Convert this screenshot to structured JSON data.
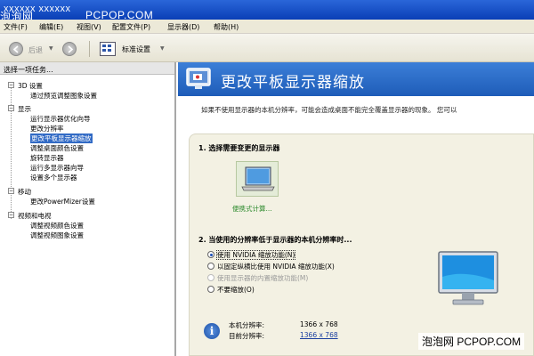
{
  "window": {
    "title": "xxxxxx  xxxxxx"
  },
  "watermark": {
    "top_cn": "泡泡网",
    "top_en": "PCPOP.COM",
    "bottom": "泡泡网  PCPOP.COM"
  },
  "menu": [
    {
      "label": "文件(F)"
    },
    {
      "label": "编辑(E)"
    },
    {
      "label": "视图(V)"
    },
    {
      "label": "配置文件(P)"
    },
    {
      "label": "显示器(D)"
    },
    {
      "label": "帮助(H)"
    }
  ],
  "toolbar": {
    "back_label": "后退",
    "standard_label": "标准设置"
  },
  "sidebar": {
    "header": "选择一项任务...",
    "groups": [
      {
        "label": "3D 设置",
        "items": [
          "通过预览调整图象设置"
        ]
      },
      {
        "label": "显示",
        "items": [
          "运行显示器优化向导",
          "更改分辨率",
          "更改平板显示器缩放",
          "调整桌面颜色设置",
          "旋转显示器",
          "运行多显示器向导",
          "设置多个显示器"
        ]
      },
      {
        "label": "移动",
        "items": [
          "更改PowerMizer设置"
        ]
      },
      {
        "label": "视频和电视",
        "items": [
          "调整视频颜色设置",
          "调整视频图象设置"
        ]
      }
    ],
    "selected": "更改平板显示器缩放"
  },
  "content": {
    "title": "更改平板显示器缩放",
    "description": "如果不使用显示器的本机分辨率，可能会造成桌面不能完全覆盖显示器的现象。 您可以",
    "step1": "1. 选择需要变更的显示器",
    "display_label": "便携式计算...",
    "step2": "2. 当使用的分辨率低于显示器的本机分辨率时...",
    "options": [
      {
        "label": "使用 NVIDIA 缩放功能(N)",
        "selected": true,
        "disabled": false
      },
      {
        "label": "以固定纵横比使用 NVIDIA 缩放功能(X)",
        "selected": false,
        "disabled": false
      },
      {
        "label": "使用显示器的内置缩放功能(M)",
        "selected": false,
        "disabled": true
      },
      {
        "label": "不要缩放(O)",
        "selected": false,
        "disabled": false
      }
    ],
    "native_res_label": "本机分辨率:",
    "native_res_value": "1366 x 768",
    "current_res_label": "目前分辨率:",
    "current_res_value": "1366 x 768"
  },
  "colors": {
    "banner": "#2a6fcc",
    "selection": "#316ac5",
    "panel": "#f3f1e3"
  }
}
